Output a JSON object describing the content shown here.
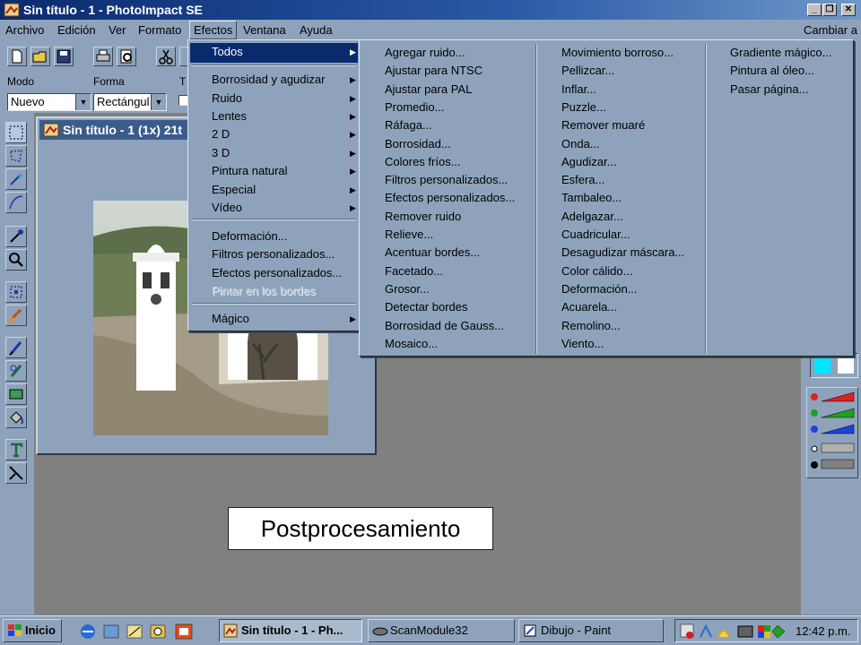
{
  "window": {
    "title": "Sin título - 1 - PhotoImpact SE",
    "minimize_glyph": "_",
    "restore_glyph": "❐",
    "close_glyph": "✕"
  },
  "menubar": {
    "items": [
      "Archivo",
      "Edición",
      "Ver",
      "Formato",
      "Efectos",
      "Ventana",
      "Ayuda"
    ],
    "right_label": "Cambiar a"
  },
  "attrbar": {
    "modo_label": "Modo",
    "modo_value": "Nuevo",
    "forma_label": "Forma",
    "forma_value": "Rectángul",
    "t_label": "T"
  },
  "document": {
    "title": "Sin título - 1 (1x) 21t"
  },
  "efectos_menu": {
    "items": [
      {
        "label": "Todos",
        "submenu": true,
        "highlight": true
      },
      {
        "label": "Borrosidad y agudizar",
        "submenu": true
      },
      {
        "label": "Ruido",
        "submenu": true
      },
      {
        "label": "Lentes",
        "submenu": true
      },
      {
        "label": "2 D",
        "submenu": true
      },
      {
        "label": "3 D",
        "submenu": true
      },
      {
        "label": "Pintura natural",
        "submenu": true
      },
      {
        "label": "Especial",
        "submenu": true
      },
      {
        "label": "Vídeo",
        "submenu": true
      },
      {
        "label": "Deformación...",
        "submenu": false
      },
      {
        "label": "Filtros personalizados...",
        "submenu": false
      },
      {
        "label": "Efectos personalizados...",
        "submenu": false
      },
      {
        "label": "Pintar en los bordes",
        "submenu": false,
        "disabled": true
      },
      {
        "label": "Mágico",
        "submenu": true
      }
    ]
  },
  "todos_submenu": {
    "col1": [
      "Agregar ruido...",
      "Ajustar para NTSC",
      "Ajustar para PAL",
      "Promedio...",
      "Ráfaga...",
      "Borrosidad...",
      "Colores fríos...",
      "Filtros personalizados...",
      "Efectos personalizados...",
      "Remover ruido",
      "Relieve...",
      "Acentuar bordes...",
      "Facetado...",
      "Grosor...",
      "Detectar bordes",
      "Borrosidad de Gauss...",
      "Mosaico..."
    ],
    "col2": [
      "Movimiento borroso...",
      "Pellizcar...",
      "Inflar...",
      "Puzzle...",
      "Remover muaré",
      "Onda...",
      "Agudizar...",
      "Esfera...",
      "Tambaleo...",
      "Adelgazar...",
      "Cuadricular...",
      "Desagudizar máscara...",
      "Color cálido...",
      "Deformación...",
      "Acuarela...",
      "Remolino...",
      "Viento..."
    ],
    "col3": [
      "Gradiente mágico...",
      "Pintura al óleo...",
      "Pasar página..."
    ]
  },
  "caption": "Postprocesamiento",
  "taskbar": {
    "start": "Inicio",
    "buttons": [
      "Sin título - 1 - Ph...",
      "ScanModule32",
      "Dibujo - Paint"
    ],
    "clock": "12:42 p.m."
  },
  "colors": {
    "title_dark": "#0a2a6e",
    "chrome": "#8ea3bb",
    "desktop": "#808080",
    "foreground_swatch": "#00e5ff",
    "background_swatch": "#ffffff"
  }
}
